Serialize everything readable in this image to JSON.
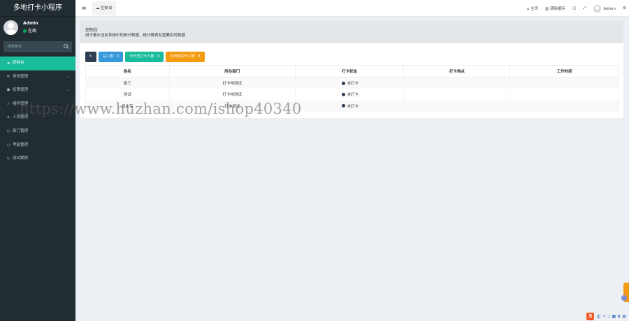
{
  "sidebar": {
    "brand": "多地打卡小程序",
    "user": {
      "name": "Admin",
      "status": "在线"
    },
    "search_placeholder": "搜索菜单",
    "items": [
      {
        "label": "控制台",
        "icon": "dashboard-icon",
        "glyph": "☁",
        "active": true,
        "has_children": false
      },
      {
        "label": "常规管理",
        "icon": "cogs-icon",
        "glyph": "⚙",
        "active": false,
        "has_children": true
      },
      {
        "label": "权限管理",
        "icon": "group-icon",
        "glyph": "☗",
        "active": false,
        "has_children": true
      },
      {
        "label": "插件管理",
        "icon": "rocket-icon",
        "glyph": "➶",
        "active": false,
        "has_children": false
      },
      {
        "label": "人员管理",
        "icon": "user-icon",
        "glyph": "♙",
        "active": false,
        "has_children": false
      },
      {
        "label": "部门管理",
        "icon": "circle-icon",
        "glyph": "○",
        "active": false,
        "has_children": false
      },
      {
        "label": "考勤管理",
        "icon": "circle-icon",
        "glyph": "○",
        "active": false,
        "has_children": false
      },
      {
        "label": "测试案例",
        "icon": "circle-icon",
        "glyph": "○",
        "active": false,
        "has_children": false
      }
    ]
  },
  "topbar": {
    "toggle_glyph": "≡",
    "tab_label": "控制台",
    "home": "主页",
    "clear_cache": "清除缓存",
    "admin": "Admin"
  },
  "content": {
    "title": "控制台",
    "description": "用于展示当前系统中的统计数据、统计报表及重要实时数据"
  },
  "toolbar": {
    "refresh_glyph": "↻",
    "total": "总人数：3",
    "checked_today": "今日已打卡人数：0",
    "unchecked_today": "今日未打卡人数：3"
  },
  "table": {
    "headers": [
      "姓名",
      "所在部门",
      "打卡状态",
      "打卡地点",
      "工作时间"
    ],
    "rows": [
      {
        "name": "张三",
        "dept": "打卡地测试",
        "status": "未打卡",
        "place": "",
        "time": ""
      },
      {
        "name": "测试",
        "dept": "打卡地测试",
        "status": "未打卡",
        "place": "",
        "time": ""
      },
      {
        "name": "张志军",
        "dept": "打卡测试",
        "status": "未打卡",
        "place": "",
        "time": ""
      }
    ]
  },
  "watermark": "https://www.huzhan.com/ishop40340",
  "ime": {
    "logo": "S",
    "mode": "中",
    "symbols": "•, ♪ ▦ ♛ ▤"
  }
}
